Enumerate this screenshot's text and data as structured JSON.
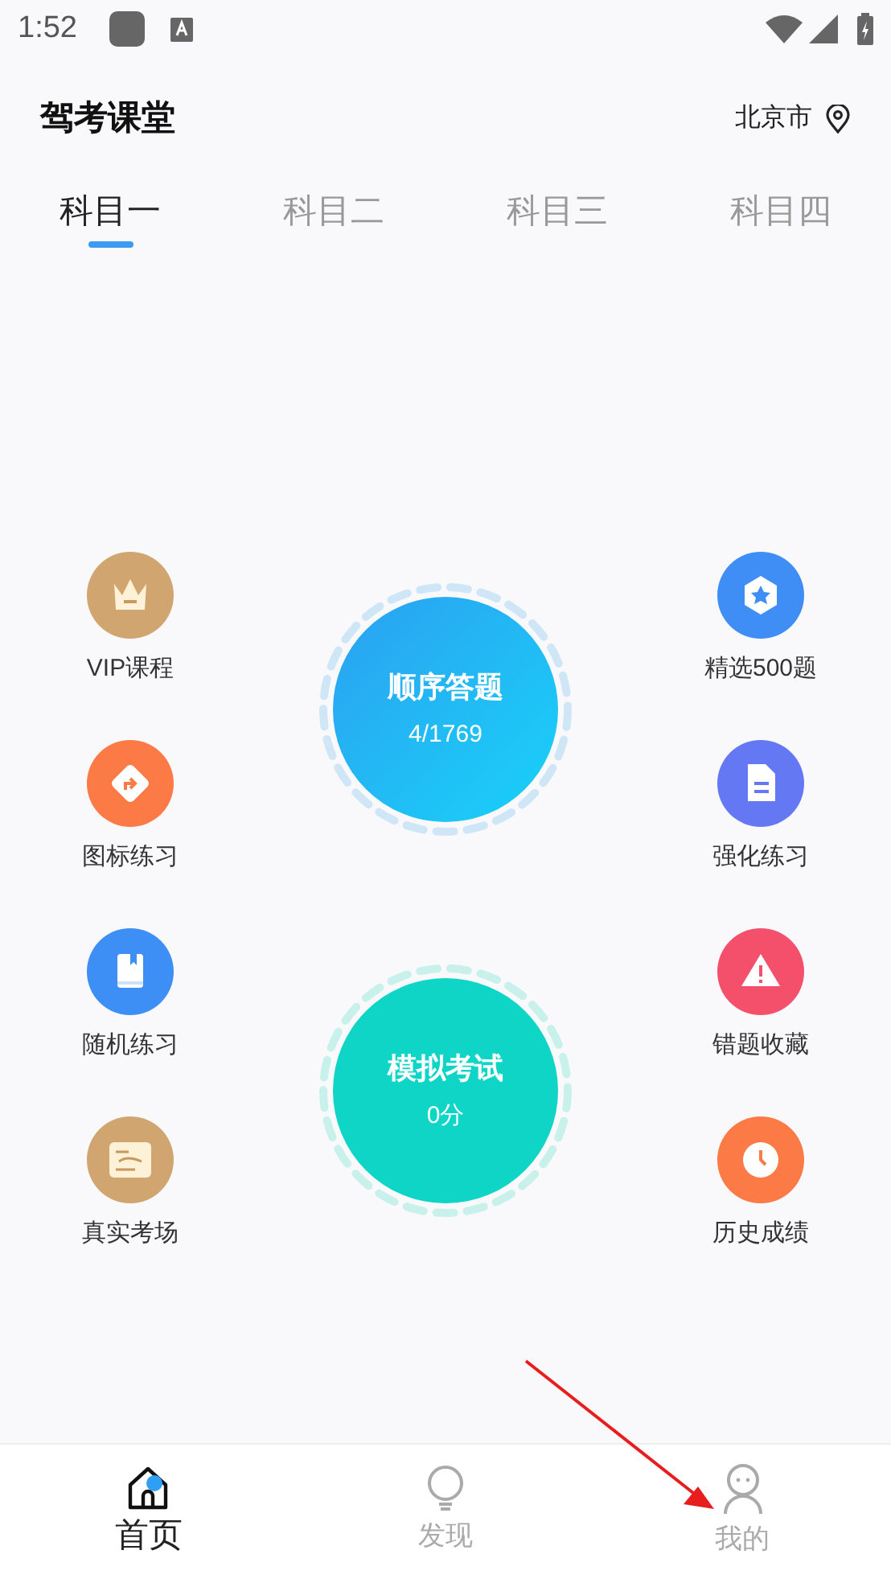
{
  "status_bar": {
    "time": "1:52"
  },
  "header": {
    "title": "驾考课堂",
    "city": "北京市"
  },
  "tabs": [
    {
      "label": "科目一",
      "selected": true
    },
    {
      "label": "科目二",
      "selected": false
    },
    {
      "label": "科目三",
      "selected": false
    },
    {
      "label": "科目四",
      "selected": false
    }
  ],
  "left_items": [
    {
      "label": "VIP课程"
    },
    {
      "label": "图标练习"
    },
    {
      "label": "随机练习"
    },
    {
      "label": "真实考场"
    }
  ],
  "right_items": [
    {
      "label": "精选500题"
    },
    {
      "label": "强化练习"
    },
    {
      "label": "错题收藏"
    },
    {
      "label": "历史成绩"
    }
  ],
  "center_buttons": [
    {
      "kind": "sequential",
      "title": "顺序答题",
      "subtitle": "4/1769"
    },
    {
      "kind": "mock",
      "title": "模拟考试",
      "subtitle": "0分"
    }
  ],
  "bottom_nav": [
    {
      "label": "首页",
      "selected": true
    },
    {
      "label": "发现",
      "selected": false
    },
    {
      "label": "我的",
      "selected": false
    }
  ]
}
